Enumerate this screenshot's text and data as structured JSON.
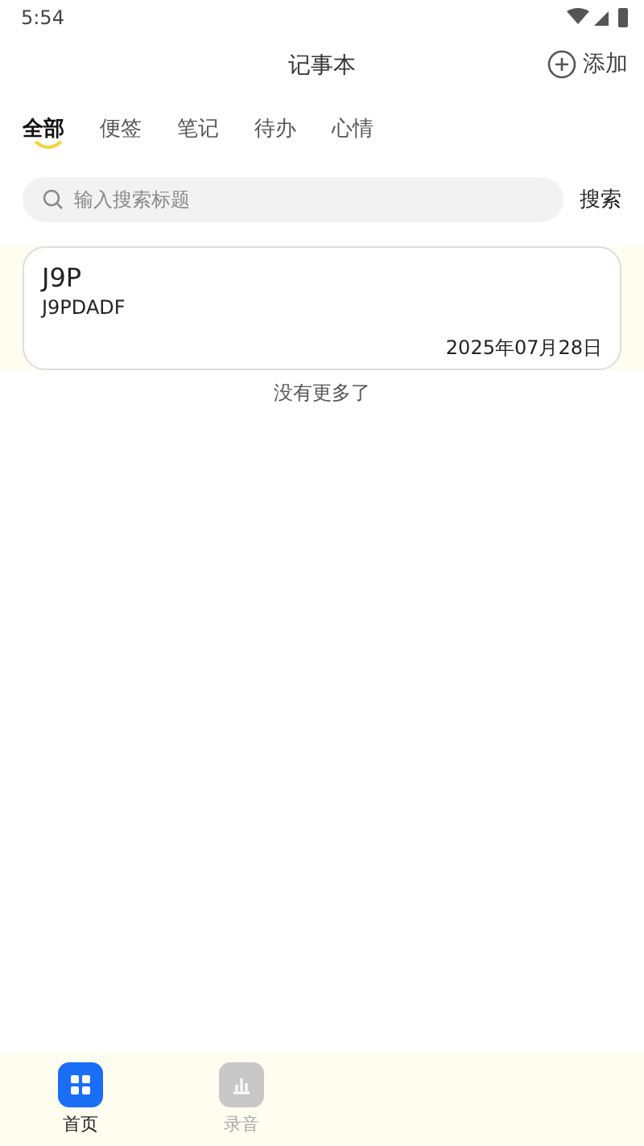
{
  "status_bar": {
    "time": "5:54"
  },
  "header": {
    "title": "记事本",
    "add_label": "添加"
  },
  "tabs": [
    {
      "label": "全部",
      "selected": true
    },
    {
      "label": "便签",
      "selected": false
    },
    {
      "label": "笔记",
      "selected": false
    },
    {
      "label": "待办",
      "selected": false
    },
    {
      "label": "心情",
      "selected": false
    }
  ],
  "search": {
    "placeholder": "输入搜索标题",
    "button": "搜索"
  },
  "notes": [
    {
      "title": "J9P",
      "body": "J9PDADF",
      "date": "2025年07月28日"
    }
  ],
  "list_end": "没有更多了",
  "bottom_nav": [
    {
      "label": "首页",
      "kind": "home",
      "selected": true
    },
    {
      "label": "录音",
      "kind": "record",
      "selected": false
    }
  ]
}
